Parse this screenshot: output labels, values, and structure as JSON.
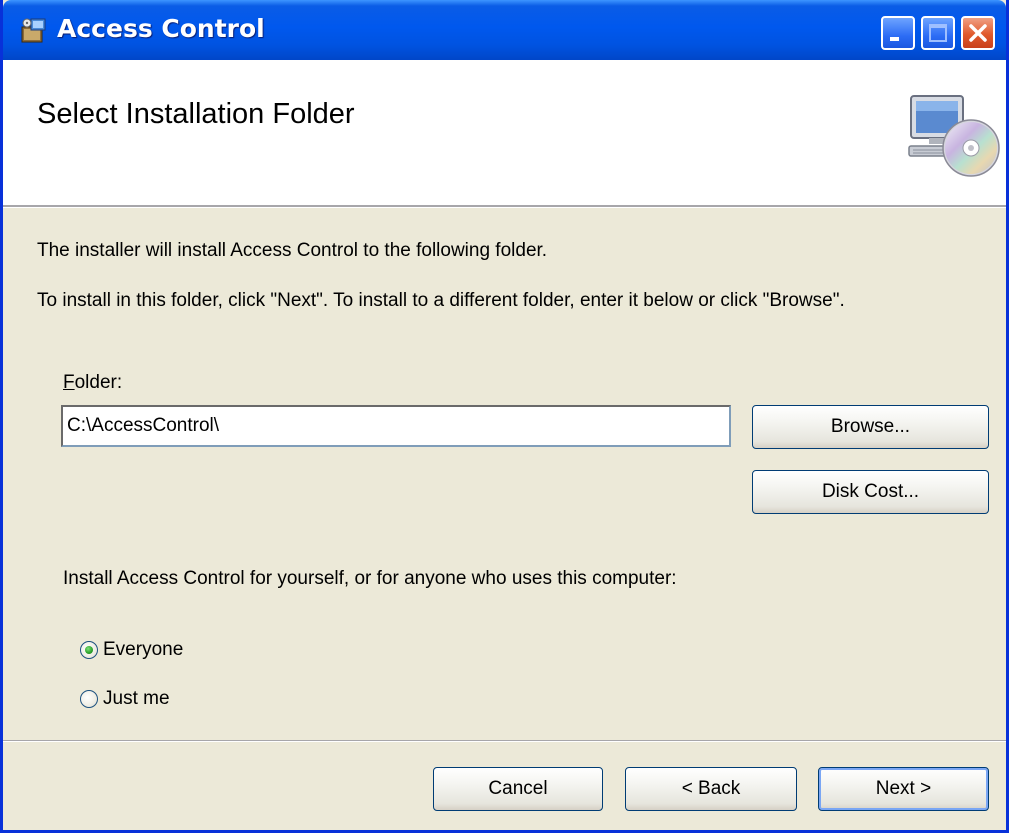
{
  "window": {
    "title": "Access Control"
  },
  "banner": {
    "title": "Select Installation Folder",
    "icon": "computer-cd-icon"
  },
  "body": {
    "intro": "The installer will install Access Control to the following folder.",
    "instructions": "To install in this folder, click \"Next\". To install to a different folder, enter it below or click \"Browse\"."
  },
  "folder": {
    "label_accel": "F",
    "label_rest": "older:",
    "value": "C:\\AccessControl\\"
  },
  "buttons": {
    "browse": "Browse...",
    "disk_cost": "Disk Cost...",
    "cancel": "Cancel",
    "back": "< Back",
    "next": "Next >"
  },
  "install_for": {
    "prompt": "Install Access Control for yourself, or for anyone who uses this computer:",
    "options": [
      {
        "label": "Everyone",
        "selected": true
      },
      {
        "label": "Just me",
        "selected": false
      }
    ]
  },
  "colors": {
    "titlebar": "#0058ee",
    "dialog_bg": "#ece9d8",
    "close_button": "#e05a2c"
  }
}
